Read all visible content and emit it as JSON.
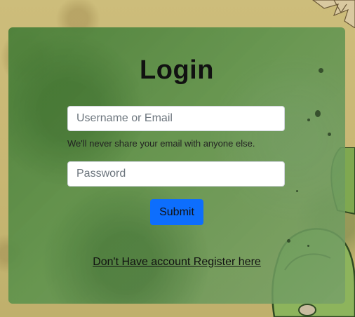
{
  "login": {
    "title": "Login",
    "username_placeholder": "Username or Email",
    "username_value": "",
    "help_text": "We'll never share your email with anyone else.",
    "password_placeholder": "Password",
    "password_value": "",
    "submit_label": "Submit",
    "register_link": "Don't Have account Register here"
  },
  "colors": {
    "submit_button": "#0d6efd",
    "card_green": "#5a9148",
    "page_background": "#c8b673"
  }
}
